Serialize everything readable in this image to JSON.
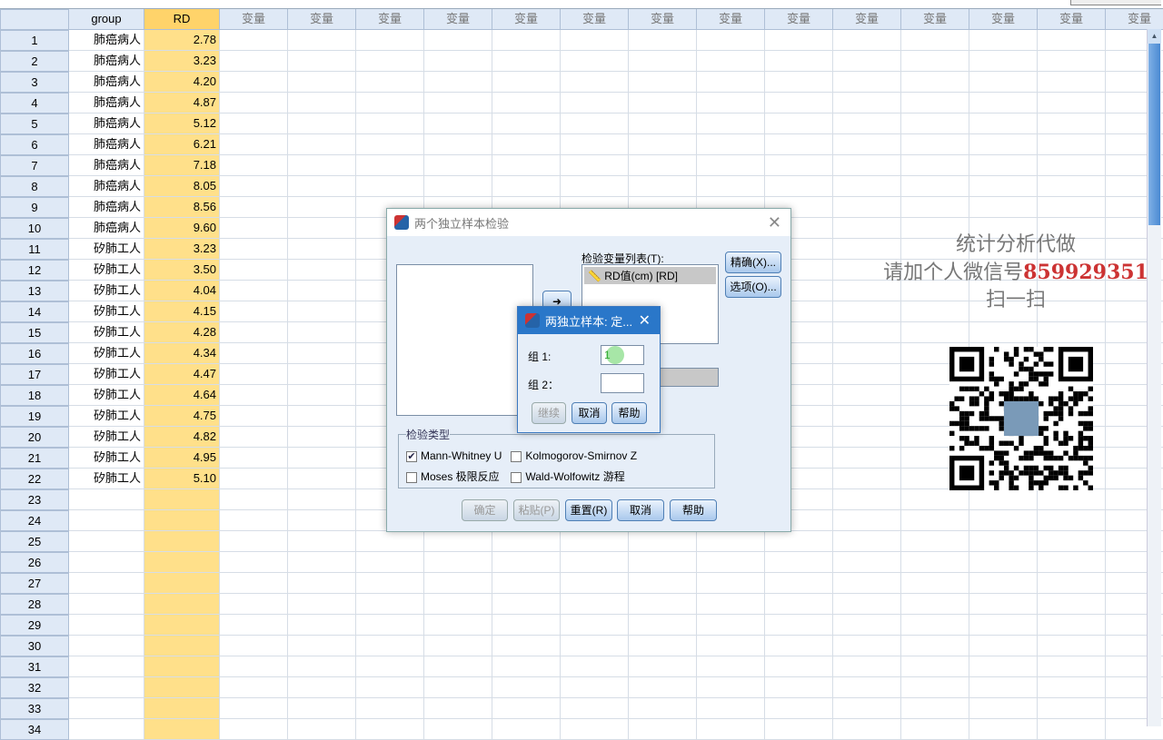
{
  "grid": {
    "headers": {
      "group": "group",
      "rd": "RD",
      "var": "变量"
    },
    "var_columns": 14,
    "rows": [
      {
        "n": "1",
        "group": "肺癌病人",
        "rd": "2.78"
      },
      {
        "n": "2",
        "group": "肺癌病人",
        "rd": "3.23"
      },
      {
        "n": "3",
        "group": "肺癌病人",
        "rd": "4.20"
      },
      {
        "n": "4",
        "group": "肺癌病人",
        "rd": "4.87"
      },
      {
        "n": "5",
        "group": "肺癌病人",
        "rd": "5.12"
      },
      {
        "n": "6",
        "group": "肺癌病人",
        "rd": "6.21"
      },
      {
        "n": "7",
        "group": "肺癌病人",
        "rd": "7.18"
      },
      {
        "n": "8",
        "group": "肺癌病人",
        "rd": "8.05"
      },
      {
        "n": "9",
        "group": "肺癌病人",
        "rd": "8.56"
      },
      {
        "n": "10",
        "group": "肺癌病人",
        "rd": "9.60"
      },
      {
        "n": "11",
        "group": "矽肺工人",
        "rd": "3.23"
      },
      {
        "n": "12",
        "group": "矽肺工人",
        "rd": "3.50"
      },
      {
        "n": "13",
        "group": "矽肺工人",
        "rd": "4.04"
      },
      {
        "n": "14",
        "group": "矽肺工人",
        "rd": "4.15"
      },
      {
        "n": "15",
        "group": "矽肺工人",
        "rd": "4.28"
      },
      {
        "n": "16",
        "group": "矽肺工人",
        "rd": "4.34"
      },
      {
        "n": "17",
        "group": "矽肺工人",
        "rd": "4.47"
      },
      {
        "n": "18",
        "group": "矽肺工人",
        "rd": "4.64"
      },
      {
        "n": "19",
        "group": "矽肺工人",
        "rd": "4.75"
      },
      {
        "n": "20",
        "group": "矽肺工人",
        "rd": "4.82"
      },
      {
        "n": "21",
        "group": "矽肺工人",
        "rd": "4.95"
      },
      {
        "n": "22",
        "group": "矽肺工人",
        "rd": "5.10"
      },
      {
        "n": "23",
        "group": "",
        "rd": ""
      },
      {
        "n": "24",
        "group": "",
        "rd": ""
      },
      {
        "n": "25",
        "group": "",
        "rd": ""
      },
      {
        "n": "26",
        "group": "",
        "rd": ""
      },
      {
        "n": "27",
        "group": "",
        "rd": ""
      },
      {
        "n": "28",
        "group": "",
        "rd": ""
      },
      {
        "n": "29",
        "group": "",
        "rd": ""
      },
      {
        "n": "30",
        "group": "",
        "rd": ""
      },
      {
        "n": "31",
        "group": "",
        "rd": ""
      },
      {
        "n": "32",
        "group": "",
        "rd": ""
      },
      {
        "n": "33",
        "group": "",
        "rd": ""
      },
      {
        "n": "34",
        "group": "",
        "rd": ""
      }
    ]
  },
  "main_dialog": {
    "title": "两个独立样本检验",
    "test_var_label": "检验变量列表(T):",
    "test_var_item": "RD值(cm) [RD]",
    "exact_btn": "精确(X)...",
    "options_btn": "选项(O)...",
    "test_type_legend": "检验类型",
    "checks": [
      {
        "label": "Mann-Whitney U",
        "checked": true
      },
      {
        "label": "Kolmogorov-Smirnov Z",
        "checked": false
      },
      {
        "label": "Moses 极限反应",
        "checked": false
      },
      {
        "label": "Wald-Wolfowitz 游程",
        "checked": false
      }
    ],
    "ok": "确定",
    "paste": "粘贴(P)",
    "reset": "重置(R)",
    "cancel": "取消",
    "help": "帮助"
  },
  "define_dialog": {
    "title": "两独立样本: 定...",
    "group1_label": "组 1:",
    "group1_value": "1",
    "group2_label": "组 2：",
    "group2_value": "",
    "continue": "继续",
    "cancel": "取消",
    "help": "帮助"
  },
  "watermark": {
    "line1": "统计分析代做",
    "line2": "请加个人微信号",
    "number": "859929351",
    "line3": "扫一扫"
  }
}
